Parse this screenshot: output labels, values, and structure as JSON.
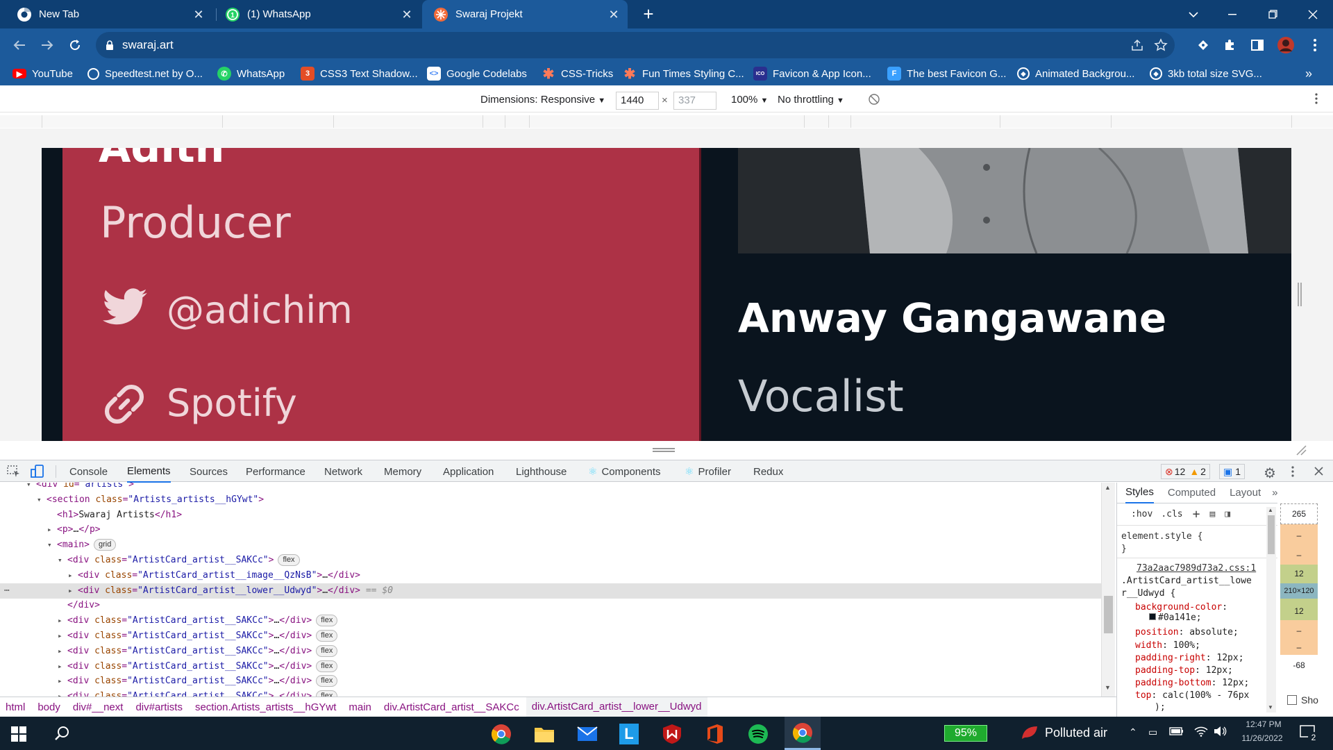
{
  "tabs": [
    {
      "title": "New Tab",
      "icon": "chrome-icon"
    },
    {
      "title": "(1) WhatsApp",
      "icon": "whatsapp-icon"
    },
    {
      "title": "Swaraj Projekt",
      "icon": "swaraj-icon"
    }
  ],
  "address": {
    "url": "swaraj.art"
  },
  "bookmarks": [
    {
      "label": "YouTube",
      "color": "#ff0000"
    },
    {
      "label": "Speedtest.net by O...",
      "color": "#141526"
    },
    {
      "label": "WhatsApp",
      "color": "#25d366"
    },
    {
      "label": "CSS3 Text Shadow...",
      "color": "#e44d26"
    },
    {
      "label": "Google Codelabs",
      "color": "#ffffff"
    },
    {
      "label": "CSS-Tricks",
      "color": "#ff7a59"
    },
    {
      "label": "Fun Times Styling C...",
      "color": "#ff7a59"
    },
    {
      "label": "Favicon & App Icon...",
      "color": "#2a2f8f"
    },
    {
      "label": "The best Favicon G...",
      "color": "#3aa0ff"
    },
    {
      "label": "Animated Backgrou...",
      "color": "#ffffff"
    },
    {
      "label": "3kb total size SVG...",
      "color": "#ffffff"
    }
  ],
  "device_bar": {
    "dimensions_label": "Dimensions: Responsive",
    "width": "1440",
    "times": "×",
    "height_placeholder": "337",
    "zoom": "100%",
    "throttle": "No throttling"
  },
  "page": {
    "left_card": {
      "name_fragment": "Adith",
      "role": "Producer",
      "twitter": "@adichim",
      "spotify": "Spotify"
    },
    "right_card": {
      "name": "Anway Gangawane",
      "role": "Vocalist"
    }
  },
  "devtools": {
    "tabs": [
      "Console",
      "Elements",
      "Sources",
      "Performance",
      "Network",
      "Memory",
      "Application",
      "Lighthouse",
      "Components",
      "Profiler",
      "Redux"
    ],
    "selected_tab": "Elements",
    "errors": "12",
    "warnings": "2",
    "messages": "1",
    "dom_lines": [
      {
        "depth": 0,
        "arrow": "▾",
        "parts": [
          [
            "tg",
            "<div "
          ],
          [
            "an",
            "id"
          ],
          [
            "tg",
            "="
          ],
          [
            "av",
            "\"artists\""
          ],
          [
            "tg",
            ">"
          ]
        ],
        "pill": ""
      },
      {
        "depth": 1,
        "arrow": "▾",
        "parts": [
          [
            "tg",
            "<section "
          ],
          [
            "an",
            "class"
          ],
          [
            "tg",
            "="
          ],
          [
            "av",
            "\"Artists_artists__hGYwt\""
          ],
          [
            "tg",
            ">"
          ]
        ],
        "pill": ""
      },
      {
        "depth": 2,
        "arrow": "",
        "parts": [
          [
            "tg",
            "<h1>"
          ],
          [
            "tx",
            "Swaraj Artists"
          ],
          [
            "tg",
            "</h1>"
          ]
        ],
        "pill": ""
      },
      {
        "depth": 2,
        "arrow": "▸",
        "parts": [
          [
            "tg",
            "<p>"
          ],
          [
            "tx",
            "…"
          ],
          [
            "tg",
            "</p>"
          ]
        ],
        "pill": ""
      },
      {
        "depth": 2,
        "arrow": "▾",
        "parts": [
          [
            "tg",
            "<main>"
          ]
        ],
        "pill": "grid"
      },
      {
        "depth": 3,
        "arrow": "▾",
        "parts": [
          [
            "tg",
            "<div "
          ],
          [
            "an",
            "class"
          ],
          [
            "tg",
            "="
          ],
          [
            "av",
            "\"ArtistCard_artist__SAKCc\""
          ],
          [
            "tg",
            ">"
          ]
        ],
        "pill": "flex"
      },
      {
        "depth": 4,
        "arrow": "▸",
        "parts": [
          [
            "tg",
            "<div "
          ],
          [
            "an",
            "class"
          ],
          [
            "tg",
            "="
          ],
          [
            "av",
            "\"ArtistCard_artist__image__QzNsB\""
          ],
          [
            "tg",
            ">"
          ],
          [
            "tx",
            "…"
          ],
          [
            "tg",
            "</div>"
          ]
        ],
        "pill": ""
      },
      {
        "depth": 4,
        "arrow": "▸",
        "parts": [
          [
            "tg",
            "<div "
          ],
          [
            "an",
            "class"
          ],
          [
            "tg",
            "="
          ],
          [
            "av",
            "\"ArtistCard_artist__lower__Udwyd\""
          ],
          [
            "tg",
            ">"
          ],
          [
            "tx",
            "…"
          ],
          [
            "tg",
            "</div>"
          ],
          [
            "eq",
            " == $0"
          ]
        ],
        "pill": "",
        "selected": true
      },
      {
        "depth": 3,
        "arrow": "",
        "parts": [
          [
            "tg",
            "</div>"
          ]
        ],
        "pill": ""
      },
      {
        "depth": 3,
        "arrow": "▸",
        "parts": [
          [
            "tg",
            "<div "
          ],
          [
            "an",
            "class"
          ],
          [
            "tg",
            "="
          ],
          [
            "av",
            "\"ArtistCard_artist__SAKCc\""
          ],
          [
            "tg",
            ">"
          ],
          [
            "tx",
            "…"
          ],
          [
            "tg",
            "</div>"
          ]
        ],
        "pill": "flex"
      },
      {
        "depth": 3,
        "arrow": "▸",
        "parts": [
          [
            "tg",
            "<div "
          ],
          [
            "an",
            "class"
          ],
          [
            "tg",
            "="
          ],
          [
            "av",
            "\"ArtistCard_artist__SAKCc\""
          ],
          [
            "tg",
            ">"
          ],
          [
            "tx",
            "…"
          ],
          [
            "tg",
            "</div>"
          ]
        ],
        "pill": "flex"
      },
      {
        "depth": 3,
        "arrow": "▸",
        "parts": [
          [
            "tg",
            "<div "
          ],
          [
            "an",
            "class"
          ],
          [
            "tg",
            "="
          ],
          [
            "av",
            "\"ArtistCard_artist__SAKCc\""
          ],
          [
            "tg",
            ">"
          ],
          [
            "tx",
            "…"
          ],
          [
            "tg",
            "</div>"
          ]
        ],
        "pill": "flex"
      },
      {
        "depth": 3,
        "arrow": "▸",
        "parts": [
          [
            "tg",
            "<div "
          ],
          [
            "an",
            "class"
          ],
          [
            "tg",
            "="
          ],
          [
            "av",
            "\"ArtistCard_artist__SAKCc\""
          ],
          [
            "tg",
            ">"
          ],
          [
            "tx",
            "…"
          ],
          [
            "tg",
            "</div>"
          ]
        ],
        "pill": "flex"
      },
      {
        "depth": 3,
        "arrow": "▸",
        "parts": [
          [
            "tg",
            "<div "
          ],
          [
            "an",
            "class"
          ],
          [
            "tg",
            "="
          ],
          [
            "av",
            "\"ArtistCard_artist__SAKCc\""
          ],
          [
            "tg",
            ">"
          ],
          [
            "tx",
            "…"
          ],
          [
            "tg",
            "</div>"
          ]
        ],
        "pill": "flex"
      },
      {
        "depth": 3,
        "arrow": "▸",
        "parts": [
          [
            "tg",
            "<div "
          ],
          [
            "an",
            "class"
          ],
          [
            "tg",
            "="
          ],
          [
            "av",
            "\"ArtistCard_artist__SAKCc\""
          ],
          [
            "tg",
            ">"
          ],
          [
            "tx",
            "…"
          ],
          [
            "tg",
            "</div>"
          ]
        ],
        "pill": "flex"
      }
    ],
    "breadcrumbs": [
      "html",
      "body",
      "div#__next",
      "div#artists",
      "section.Artists_artists__hGYwt",
      "main",
      "div.ArtistCard_artist__SAKCc",
      "div.ArtistCard_artist__lower__Udwyd"
    ],
    "styles": {
      "tabs": [
        "Styles",
        "Computed",
        "Layout"
      ],
      "hov": ":hov",
      "cls": ".cls",
      "element_style": "element.style {",
      "close": "}",
      "source": "73a2aac7989d73a2.css:1",
      "selector_1": ".ArtistCard_artist__lowe",
      "selector_2": "r__Udwyd {",
      "decls": [
        {
          "prop": "background-color",
          "val": "#0a141e;"
        },
        {
          "prop": "position",
          "val": "absolute;"
        },
        {
          "prop": "width",
          "val": "100%;"
        },
        {
          "prop": "padding-right",
          "val": "12px;"
        },
        {
          "prop": "padding-top",
          "val": "12px;"
        },
        {
          "prop": "padding-bottom",
          "val": "12px;"
        },
        {
          "prop": "top",
          "val": "calc(100% - 76px"
        }
      ],
      "tail": ");"
    },
    "box_model": [
      "265",
      "–",
      "–",
      "12",
      "210×120",
      "12",
      "–",
      "–",
      "-68"
    ],
    "show_label": "Sho"
  },
  "taskbar": {
    "battery": "95%",
    "weather": "Polluted air",
    "time": "12:47 PM",
    "date": "11/26/2022",
    "notif": "2"
  },
  "colors": {
    "accent_red": "#ad3246",
    "dark_bg": "#0a141e",
    "chrome_dark": "#0e3f73",
    "chrome": "#1c5a9b"
  }
}
